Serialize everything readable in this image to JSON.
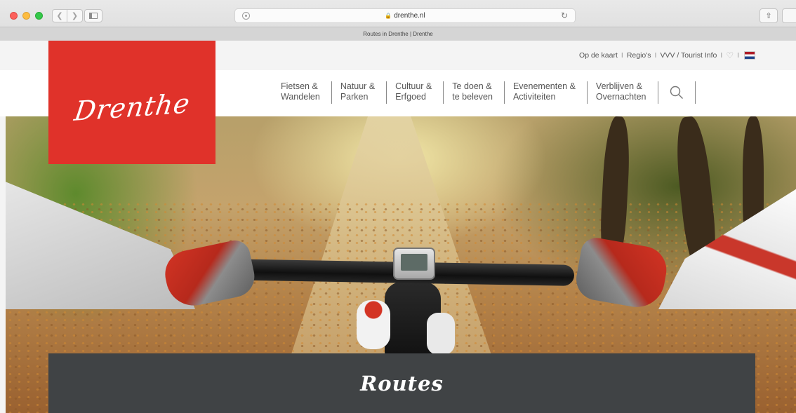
{
  "browser": {
    "url": "drenthe.nl",
    "tab_title": "Routes in Drenthe | Drenthe",
    "back_icon": "chevron-left-icon",
    "forward_icon": "chevron-right-icon",
    "reload_icon": "reload-icon",
    "share_icon": "share-icon"
  },
  "site": {
    "logo_text": "Drenthe",
    "brand_color": "#e0322a"
  },
  "toplinks": {
    "map": "Op de kaart",
    "regions": "Regio's",
    "vvv": "VVV / Tourist Info",
    "sep": "I",
    "favorites_icon": "heart-icon",
    "language_icon": "dutch-flag-icon"
  },
  "nav": {
    "items": [
      {
        "label": "Fietsen &\nWandelen"
      },
      {
        "label": "Natuur &\nParken"
      },
      {
        "label": "Cultuur &\nErfgoed"
      },
      {
        "label": "Te doen &\nte beleven"
      },
      {
        "label": "Evenementen &\nActiviteiten"
      },
      {
        "label": "Verblijven &\nOvernachten"
      }
    ],
    "search_icon": "search-icon"
  },
  "hero": {
    "banner_title": "Routes"
  }
}
